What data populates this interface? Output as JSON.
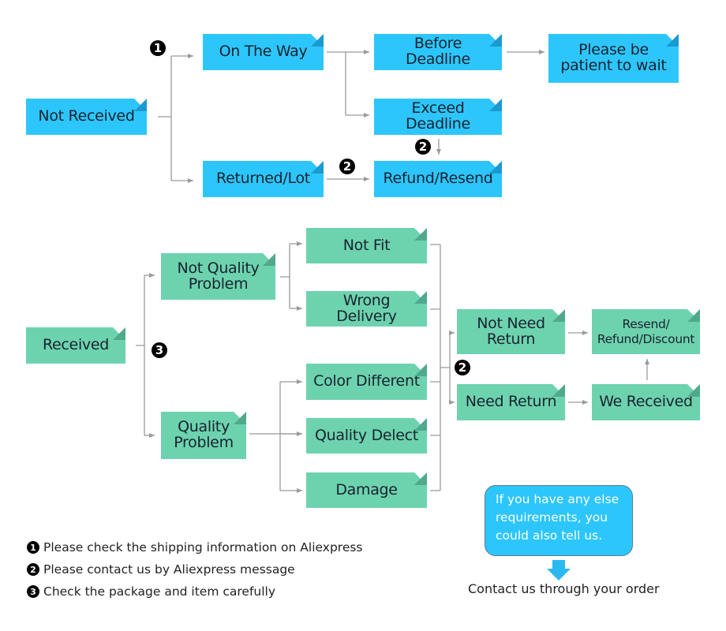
{
  "colors": {
    "not_received_branch": "#2cc6fc",
    "received_branch": "#6dd3ae",
    "connector": "#9a9a9a",
    "badge": "#000000",
    "note_fill": "#2cc6fc"
  },
  "not_received": {
    "root": "Not Received",
    "on_the_way": "On The Way",
    "returned_lot": "Returned/Lot",
    "before_deadline": "Before Deadline",
    "exceed_deadline": "Exceed Deadline",
    "refund_resend": "Refund/Resend",
    "please_wait_line1": "Please be",
    "please_wait_line2": "patient to wait"
  },
  "received": {
    "root": "Received",
    "not_quality_line1": "Not Quality",
    "not_quality_line2": "Problem",
    "quality_line1": "Quality",
    "quality_line2": "Problem",
    "not_fit": "Not Fit",
    "wrong_delivery": "Wrong Delivery",
    "color_different": "Color Different",
    "quality_defect": "Quality Delect",
    "damage": "Damage",
    "not_need_return_line1": "Not Need",
    "not_need_return_line2": "Return",
    "need_return": "Need Return",
    "resend_line1": "Resend/",
    "resend_line2": "Refund/Discount",
    "we_received": "We Received"
  },
  "badges": {
    "one": "1",
    "two": "2",
    "three": "3"
  },
  "legend": [
    {
      "num": "1",
      "text": "Please check the shipping information on Aliexpress"
    },
    {
      "num": "2",
      "text": "Please contact us by Aliexpress message"
    },
    {
      "num": "3",
      "text": "Check the package and item carefully"
    }
  ],
  "note": {
    "line1": "If you have any else",
    "line2": "requirements, you",
    "line3": "could also tell us."
  },
  "contact_text": "Contact us through your order"
}
